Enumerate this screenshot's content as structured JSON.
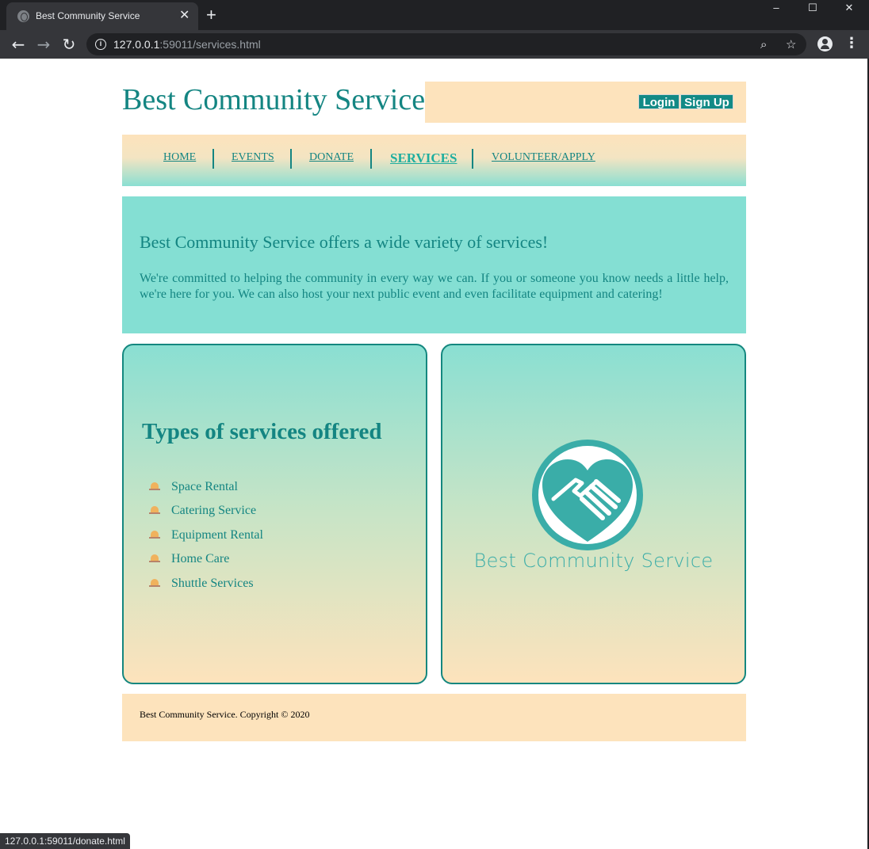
{
  "browser": {
    "tab_title": "Best Community Service",
    "tab_close": "✕",
    "new_tab": "+",
    "window_controls": {
      "minimize": "–",
      "maximize": "☐",
      "close": "✕"
    },
    "nav": {
      "back": "←",
      "forward": "→",
      "reload": "↻"
    },
    "url_host": "127.0.0.1",
    "url_rest": ":59011/services.html",
    "status_url": "127.0.0.1:59011/donate.html",
    "icons": [
      "site-info-icon",
      "zoom-icon",
      "bookmark-star-icon",
      "profile-icon",
      "menu-icon"
    ]
  },
  "header": {
    "site_title": "Best Community Service",
    "login_label": "Login",
    "signup_label": "Sign Up"
  },
  "nav": {
    "items": [
      {
        "label": "HOME"
      },
      {
        "label": "EVENTS"
      },
      {
        "label": "DONATE"
      },
      {
        "label": "SERVICES",
        "active": true
      },
      {
        "label": "VOLUNTEER/APPLY"
      }
    ]
  },
  "intro": {
    "heading": "Best Community Service offers a wide variety of services!",
    "text": "We're committed to helping the community in every way we can. If you or someone you know needs a little help, we're here for you. We can also host your next public event and even facilitate equipment and catering!"
  },
  "services": {
    "heading": "Types of services offered",
    "items": [
      "Space Rental",
      "Catering Service",
      "Equipment Rental",
      "Home Care",
      "Shuttle Services"
    ]
  },
  "logo": {
    "text": "Best Community Service"
  },
  "footer": {
    "text": "Best Community Service. Copyright © 2020"
  },
  "colors": {
    "brand_teal": "#148582",
    "peach": "#fde3bc",
    "aqua": "#84dfd3",
    "logo_teal": "#3aada8",
    "button_teal": "#128a86"
  }
}
